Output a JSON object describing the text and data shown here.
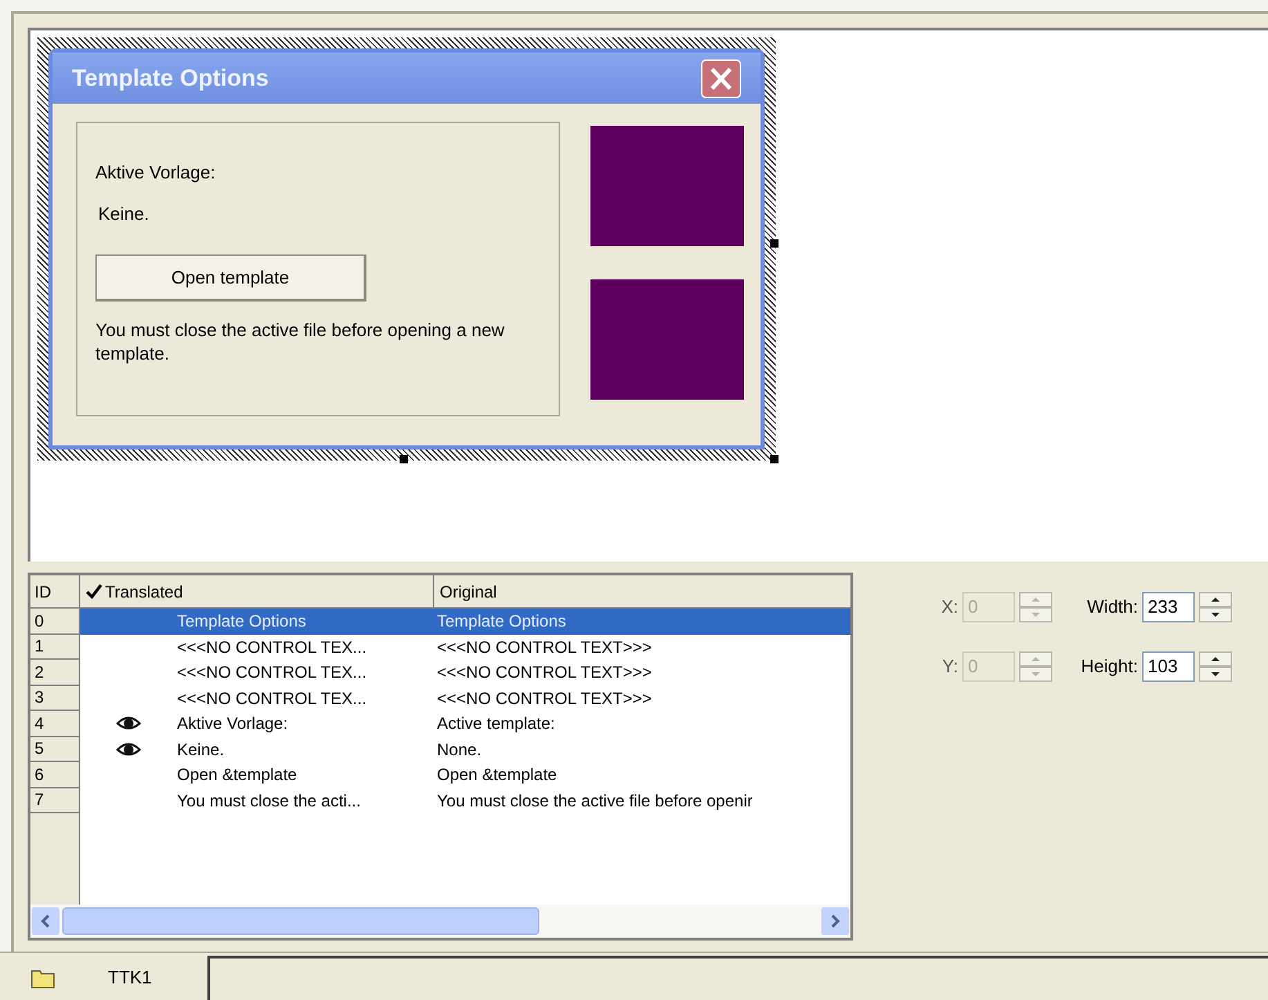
{
  "dialog": {
    "title": "Template Options",
    "label": "Aktive Vorlage:",
    "value": "Keine.",
    "button": "Open template",
    "message": "You must close the active file before opening a new template."
  },
  "table": {
    "columns": [
      "ID",
      "Translated",
      "Original"
    ],
    "rows": [
      {
        "id": "0",
        "translated": "Template Options",
        "original": "Template Options",
        "eye": false,
        "selected": true
      },
      {
        "id": "1",
        "translated": "<<<NO CONTROL TEX...",
        "original": "<<<NO CONTROL TEXT>>>",
        "eye": false,
        "selected": false
      },
      {
        "id": "2",
        "translated": "<<<NO CONTROL TEX...",
        "original": "<<<NO CONTROL TEXT>>>",
        "eye": false,
        "selected": false
      },
      {
        "id": "3",
        "translated": "<<<NO CONTROL TEX...",
        "original": "<<<NO CONTROL TEXT>>>",
        "eye": false,
        "selected": false
      },
      {
        "id": "4",
        "translated": "Aktive Vorlage:",
        "original": "Active template:",
        "eye": true,
        "selected": false
      },
      {
        "id": "5",
        "translated": "Keine.",
        "original": "None.",
        "eye": true,
        "selected": false
      },
      {
        "id": "6",
        "translated": "Open &template",
        "original": "Open &template",
        "eye": false,
        "selected": false
      },
      {
        "id": "7",
        "translated": "You must close the acti...",
        "original": "You must close the active file before openir",
        "eye": false,
        "selected": false
      }
    ]
  },
  "properties": [
    {
      "label": "X:",
      "value": "0",
      "disabled": true
    },
    {
      "label": "Width:",
      "value": "233",
      "disabled": false
    },
    {
      "label": "Y:",
      "value": "0",
      "disabled": true
    },
    {
      "label": "Height:",
      "value": "103",
      "disabled": false
    }
  ],
  "tabs": [
    {
      "label": "TTK1",
      "selected": true
    }
  ]
}
